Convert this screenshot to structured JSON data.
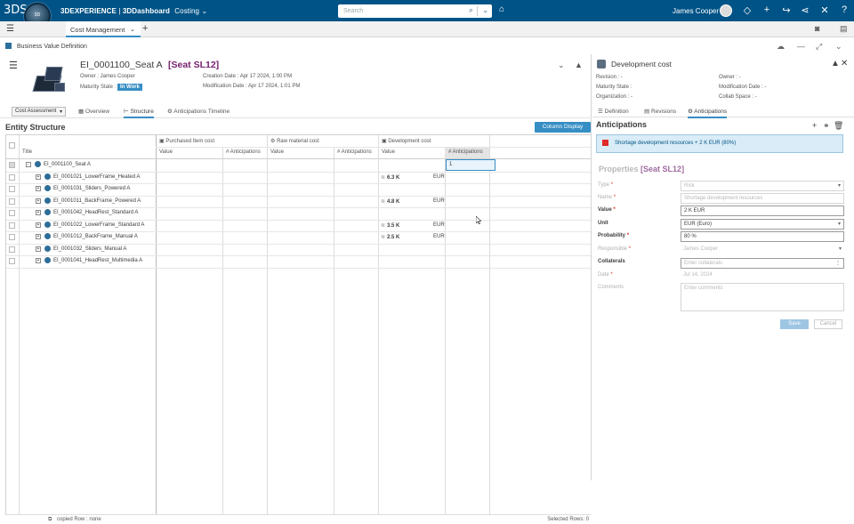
{
  "topbar": {
    "brand_logo": "3DS",
    "compass_top": "3D",
    "compass_bottom": "V,R",
    "app_brand": "3DEXPERIENCE",
    "app_sep": " | ",
    "app_product": "3DDashboard",
    "app_module": "Costing",
    "search_placeholder": "Search",
    "user_name": "James Cooper",
    "icons": [
      "tag-icon",
      "share-icon",
      "add-icon",
      "forward-icon",
      "network-icon",
      "tools-icon",
      "help-icon"
    ]
  },
  "tabbar": {
    "tab_label": "Cost Management",
    "plus": "+"
  },
  "bvbar": {
    "title": "Business Value Definition"
  },
  "object": {
    "name": "EI_0001100_Seat A",
    "context": "[Seat SL12]",
    "owner": "Owner : James Cooper",
    "maturity_label": "Maturity State :",
    "maturity_value": "In Work",
    "creation": "Creation Date : Apr 17 2024, 1:00 PM",
    "modification": "Modification Date : Apr 17 2024, 1:01 PM"
  },
  "subtabs": {
    "combo": "Cost Assessment",
    "items": [
      "Overview",
      "Structure",
      "Anticipations Timeline"
    ]
  },
  "structure": {
    "title": "Entity Structure",
    "column_display": "Column Display",
    "groups": [
      "Purchased Item cost",
      "Raw material cost",
      "Development cost"
    ],
    "cols": [
      "Title",
      "Value",
      "# Anticipations",
      "Value",
      "# Anticipations",
      "Value",
      "# Anticipations"
    ],
    "rows": [
      {
        "title": "EI_0001100_Seat  A",
        "exp": "-",
        "level": 0,
        "dev": "",
        "cur": "",
        "ant": "1"
      },
      {
        "title": "EI_0001021_LowerFrame_Heated  A",
        "exp": "+",
        "level": 1,
        "dev": "6.3 K",
        "cur": "EUR",
        "ant": ""
      },
      {
        "title": "EI_0001031_Sliders_Powered  A",
        "exp": "+",
        "level": 1,
        "dev": "",
        "cur": "",
        "ant": ""
      },
      {
        "title": "EI_0001011_BackFrame_Powered  A",
        "exp": "+",
        "level": 1,
        "dev": "4.8 K",
        "cur": "EUR",
        "ant": ""
      },
      {
        "title": "EI_0001042_HeadRest_Standard  A",
        "exp": "+",
        "level": 1,
        "dev": "",
        "cur": "",
        "ant": ""
      },
      {
        "title": "EI_0001022_LowerFrame_Standard  A",
        "exp": "+",
        "level": 1,
        "dev": "3.5 K",
        "cur": "EUR",
        "ant": ""
      },
      {
        "title": "EI_0001012_BackFrame_Manual  A",
        "exp": "+",
        "level": 1,
        "dev": "2.5 K",
        "cur": "EUR",
        "ant": ""
      },
      {
        "title": "EI_0001032_Sliders_Manual  A",
        "exp": "+",
        "level": 1,
        "dev": "",
        "cur": "",
        "ant": ""
      },
      {
        "title": "EI_0001041_HeadRest_Multimedia  A",
        "exp": "+",
        "level": 1,
        "dev": "",
        "cur": "",
        "ant": ""
      }
    ],
    "footer_left": "copied Row : none",
    "footer_right": "Selected Rows: 0"
  },
  "panel": {
    "title": "Development cost",
    "revision": "Revision : -",
    "maturity": "Maturity State :",
    "organization": "Organization : -",
    "owner": "Owner : -",
    "modification": "Modification Date : -",
    "collab": "Collab Space : -",
    "tabs": [
      "Definition",
      "Revisions",
      "Anticipations"
    ],
    "anticipations_title": "Anticipations",
    "banner": "Shortage development resources + 2 K EUR (80%)",
    "properties": "Properties",
    "properties_ctx": "[Seat SL12]",
    "fields": {
      "type": {
        "label": "Type",
        "value": "Risk"
      },
      "name": {
        "label": "Name",
        "value": "Shortage development resources"
      },
      "value": {
        "label": "Value",
        "value": "2 K EUR"
      },
      "unit": {
        "label": "Unit",
        "value": "EUR (Euro)"
      },
      "probability": {
        "label": "Probability",
        "value": "80 %"
      },
      "responsible": {
        "label": "Responsible",
        "value": "James Cooper"
      },
      "collaterals": {
        "label": "Collaterals",
        "placeholder": "Enter collaterals"
      },
      "date": {
        "label": "Date",
        "value": "Jul 14, 2024"
      },
      "comments": {
        "label": "Comments",
        "placeholder": "Enter comments"
      }
    },
    "save": "Save",
    "cancel": "Cancel"
  },
  "colors": {
    "topbar": "#005386",
    "accent": "#368ec4",
    "context": "#77216f"
  }
}
